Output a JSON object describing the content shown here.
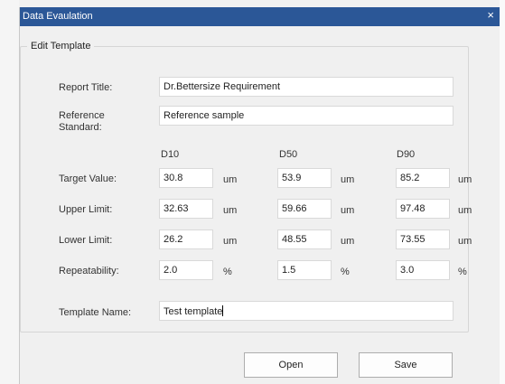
{
  "window": {
    "title": "Data Evaulation",
    "close_glyph": "×"
  },
  "group": {
    "label": "Edit Template"
  },
  "report_title": {
    "label": "Report Title:",
    "value": "Dr.Bettersize Requirement"
  },
  "reference_standard": {
    "label_line1": "Reference",
    "label_line2": "Standard:",
    "value": "Reference sample"
  },
  "columns": [
    "D10",
    "D50",
    "D90"
  ],
  "rows": [
    {
      "label": "Target Value:",
      "values": [
        "30.8",
        "53.9",
        "85.2"
      ],
      "unit": "um"
    },
    {
      "label": "Upper Limit:",
      "values": [
        "32.63",
        "59.66",
        "97.48"
      ],
      "unit": "um"
    },
    {
      "label": "Lower Limit:",
      "values": [
        "26.2",
        "48.55",
        "73.55"
      ],
      "unit": "um"
    },
    {
      "label": "Repeatability:",
      "values": [
        "2.0",
        "1.5",
        "3.0"
      ],
      "unit": "%"
    }
  ],
  "template_name": {
    "label": "Template Name:",
    "value": "Test template"
  },
  "buttons": {
    "open": "Open",
    "save": "Save"
  }
}
